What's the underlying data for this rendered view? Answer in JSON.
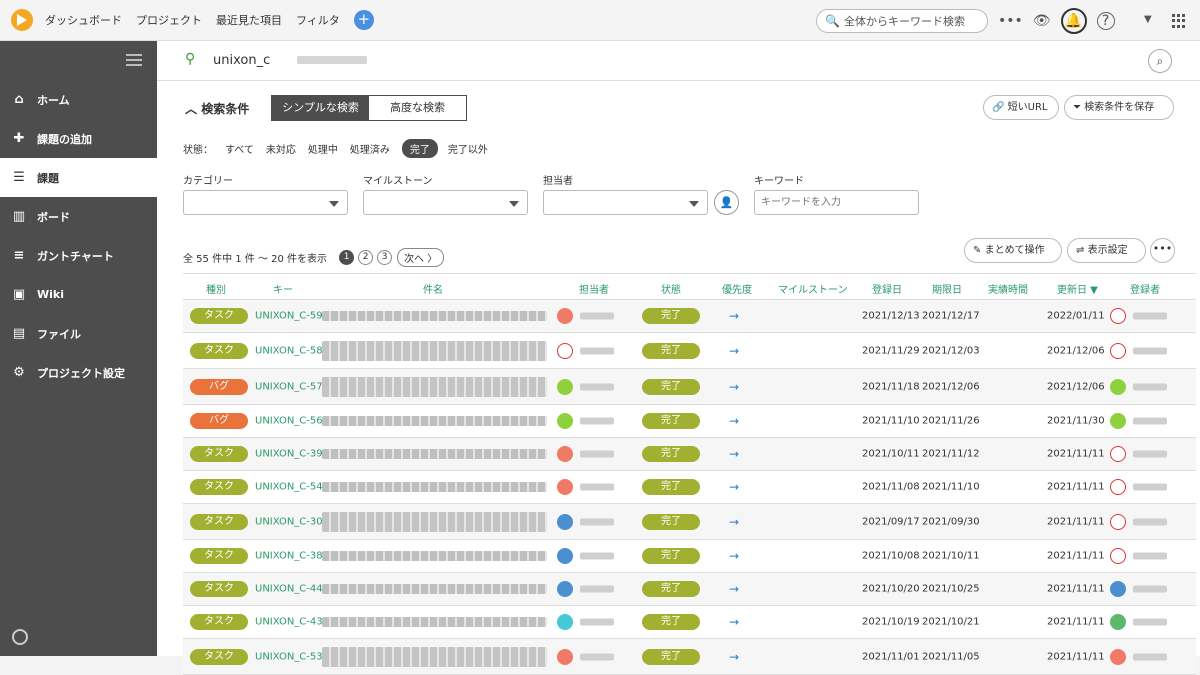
{
  "topnav": {
    "items": [
      "ダッシュボード",
      "プロジェクト",
      "最近見た項目",
      "フィルタ"
    ],
    "add_label": "+",
    "search_placeholder": "全体からキーワード検索"
  },
  "sidebar": {
    "items": [
      {
        "label": "ホーム",
        "icon": "home-icon"
      },
      {
        "label": "課題の追加",
        "icon": "plus-icon"
      },
      {
        "label": "課題",
        "icon": "list-icon"
      },
      {
        "label": "ボード",
        "icon": "board-icon"
      },
      {
        "label": "ガントチャート",
        "icon": "gantt-icon"
      },
      {
        "label": "Wiki",
        "icon": "wiki-icon"
      },
      {
        "label": "ファイル",
        "icon": "file-icon"
      },
      {
        "label": "プロジェクト設定",
        "icon": "gear-icon"
      }
    ],
    "active_index": 2
  },
  "project": {
    "name": "unixon_c"
  },
  "search": {
    "title": "検索条件",
    "simple_label": "シンプルな検索",
    "advanced_label": "高度な検索",
    "short_url_label": "短いURL",
    "save_label": "検索条件を保存",
    "status_label": "状態：",
    "statuses": [
      "すべて",
      "未対応",
      "処理中",
      "処理済み",
      "完了",
      "完了以外"
    ],
    "active_status": "完了",
    "filters": {
      "category": "カテゴリー",
      "milestone": "マイルストーン",
      "assignee": "担当者",
      "keyword": "キーワード",
      "keyword_placeholder": "キーワードを入力"
    }
  },
  "pager": {
    "summary": "全 55 件中 1 件 〜 20 件を表示",
    "pages": [
      "1",
      "2",
      "3"
    ],
    "next_label": "次へ",
    "bulk_label": "まとめて操作",
    "display_label": "表示設定",
    "more_label": "•••"
  },
  "table": {
    "headers": [
      "種別",
      "キー",
      "件名",
      "担当者",
      "状態",
      "優先度",
      "マイルストーン",
      "登録日",
      "期限日",
      "実績時間",
      "更新日 ▼",
      "登録者"
    ],
    "rows": [
      {
        "type": "タスク",
        "kind": "task",
        "key": "UNIXON_C-59",
        "status": "完了",
        "created": "2021/12/13",
        "due": "2021/12/17",
        "updated": "2022/01/11",
        "assignee_av": "red",
        "reporter_av": "stamp",
        "tall": false
      },
      {
        "type": "タスク",
        "kind": "task",
        "key": "UNIXON_C-58",
        "status": "完了",
        "created": "2021/11/29",
        "due": "2021/12/03",
        "updated": "2021/12/06",
        "assignee_av": "stamp",
        "reporter_av": "stamp",
        "tall": true
      },
      {
        "type": "バグ",
        "kind": "bug",
        "key": "UNIXON_C-57",
        "status": "完了",
        "created": "2021/11/18",
        "due": "2021/12/06",
        "updated": "2021/12/06",
        "assignee_av": "green",
        "reporter_av": "green",
        "tall": true
      },
      {
        "type": "バグ",
        "kind": "bug",
        "key": "UNIXON_C-56",
        "status": "完了",
        "created": "2021/11/10",
        "due": "2021/11/26",
        "updated": "2021/11/30",
        "assignee_av": "green",
        "reporter_av": "green",
        "tall": false
      },
      {
        "type": "タスク",
        "kind": "task",
        "key": "UNIXON_C-39",
        "status": "完了",
        "created": "2021/10/11",
        "due": "2021/11/12",
        "updated": "2021/11/11",
        "assignee_av": "red",
        "reporter_av": "stamp",
        "tall": false
      },
      {
        "type": "タスク",
        "kind": "task",
        "key": "UNIXON_C-54",
        "status": "完了",
        "created": "2021/11/08",
        "due": "2021/11/10",
        "updated": "2021/11/11",
        "assignee_av": "red",
        "reporter_av": "stamp",
        "tall": false
      },
      {
        "type": "タスク",
        "kind": "task",
        "key": "UNIXON_C-30",
        "status": "完了",
        "created": "2021/09/17",
        "due": "2021/09/30",
        "updated": "2021/11/11",
        "assignee_av": "photo",
        "reporter_av": "stamp",
        "tall": true
      },
      {
        "type": "タスク",
        "kind": "task",
        "key": "UNIXON_C-38",
        "status": "完了",
        "created": "2021/10/08",
        "due": "2021/10/11",
        "updated": "2021/11/11",
        "assignee_av": "photo",
        "reporter_av": "stamp",
        "tall": false
      },
      {
        "type": "タスク",
        "kind": "task",
        "key": "UNIXON_C-44",
        "status": "完了",
        "created": "2021/10/20",
        "due": "2021/10/25",
        "updated": "2021/11/11",
        "assignee_av": "photo",
        "reporter_av": "photo",
        "tall": false
      },
      {
        "type": "タスク",
        "kind": "task",
        "key": "UNIXON_C-43",
        "status": "完了",
        "created": "2021/10/19",
        "due": "2021/10/21",
        "updated": "2021/11/11",
        "assignee_av": "cyan",
        "reporter_av": "globe",
        "tall": false
      },
      {
        "type": "タスク",
        "kind": "task",
        "key": "UNIXON_C-53",
        "status": "完了",
        "created": "2021/11/01",
        "due": "2021/11/05",
        "updated": "2021/11/11",
        "assignee_av": "red",
        "reporter_av": "red",
        "tall": true
      }
    ]
  },
  "colors": {
    "task": "#a1b030",
    "bug": "#ea733b",
    "link": "#2a9a6a",
    "sidebar": "#4d4d4d"
  }
}
